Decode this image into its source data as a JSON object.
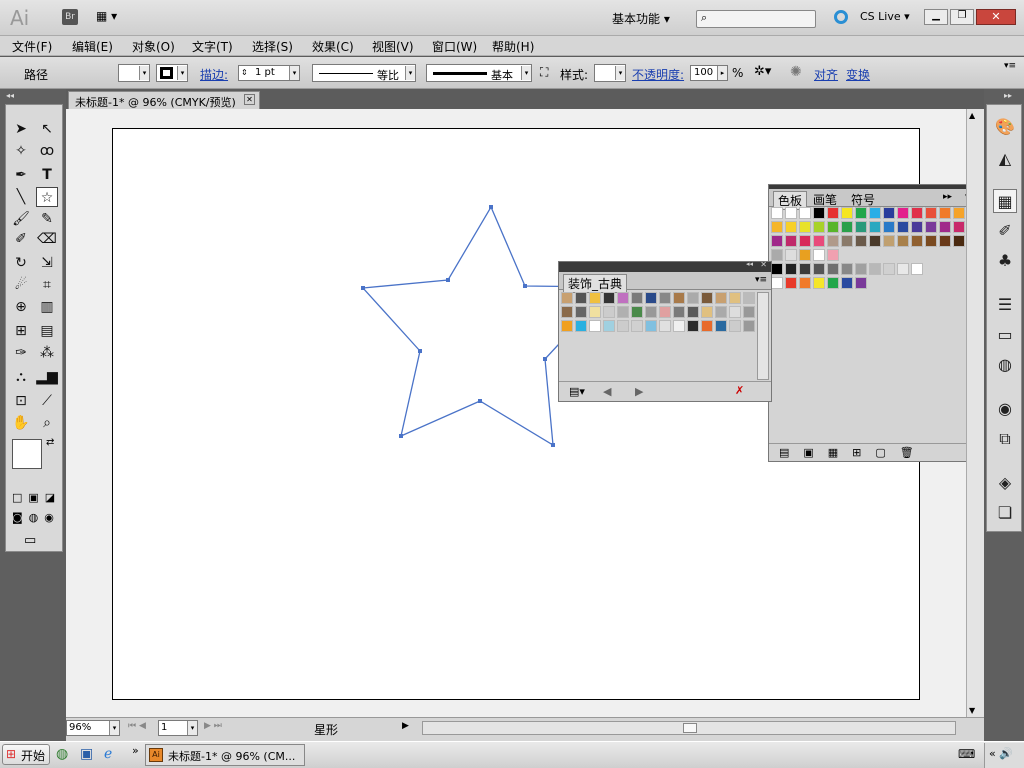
{
  "app": {
    "logo": "Ai",
    "bridge_label": "Br",
    "workspace": "基本功能",
    "search_placeholder": "",
    "cslive": "CS Live"
  },
  "menu": [
    "文件(F)",
    "编辑(E)",
    "对象(O)",
    "文字(T)",
    "选择(S)",
    "效果(C)",
    "视图(V)",
    "窗口(W)",
    "帮助(H)"
  ],
  "control": {
    "object_type": "路径",
    "stroke_link": "描边:",
    "stroke_weight": "1 pt",
    "profile": "等比",
    "brush": "基本",
    "style_label": "样式:",
    "opacity_link": "不透明度:",
    "opacity_value": "100",
    "opacity_unit": "%",
    "align_link": "对齐",
    "transform_link": "变换"
  },
  "document": {
    "tab_title": "未标题-1* @ 96% (CMYK/预览)"
  },
  "status": {
    "zoom": "96%",
    "artboard": "1",
    "tool_name": "星形"
  },
  "swatches_panel": {
    "tabs": [
      "色板",
      "画笔",
      "符号"
    ]
  },
  "library_panel": {
    "title": "装饰_古典"
  },
  "taskbar": {
    "start": "开始",
    "task": "未标题-1* @ 96% (CM..."
  },
  "colors": {
    "selection": "#4a73c8",
    "artboard": "#ffffff"
  }
}
